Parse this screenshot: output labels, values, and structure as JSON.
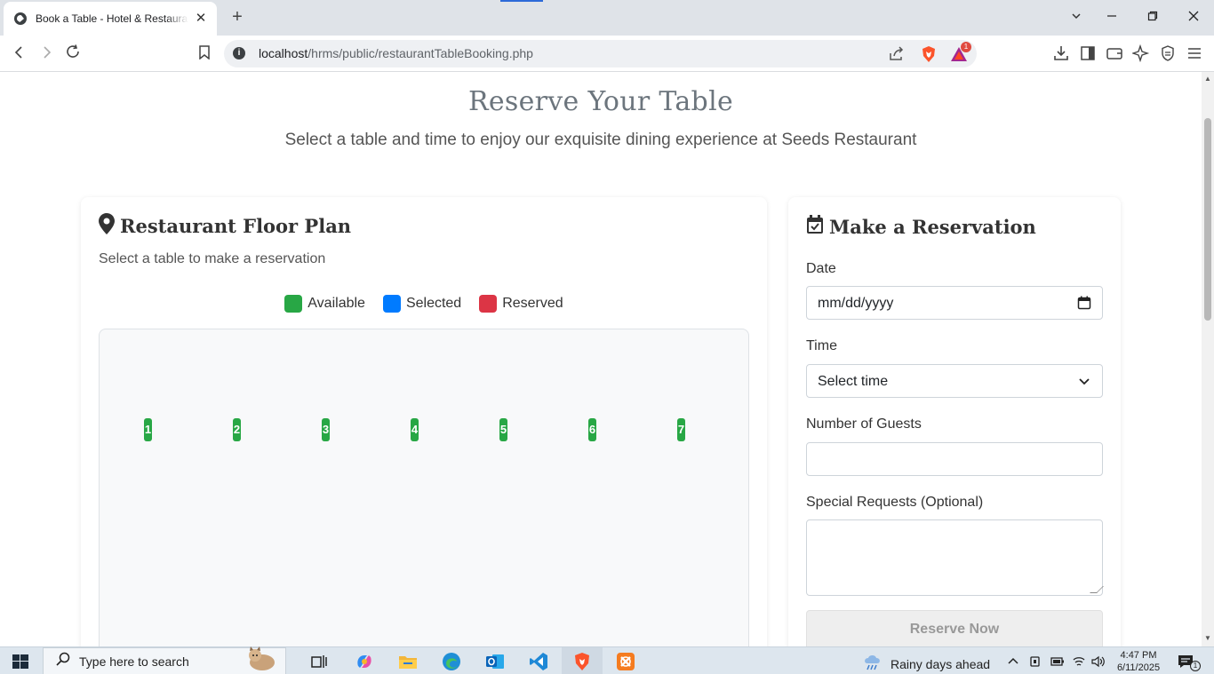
{
  "browser": {
    "tab_title": "Book a Table - Hotel & Restaurant",
    "url_host": "localhost",
    "url_path": "/hrms/public/restaurantTableBooking.php",
    "extension_badge": "1"
  },
  "page": {
    "title": "Reserve Your Table",
    "subtitle": "Select a table and time to enjoy our exquisite dining experience at Seeds Restaurant"
  },
  "floor_plan": {
    "heading": "Restaurant Floor Plan",
    "subheading": "Select a table to make a reservation",
    "legend": [
      {
        "label": "Available",
        "color": "#28a745"
      },
      {
        "label": "Selected",
        "color": "#007bff"
      },
      {
        "label": "Reserved",
        "color": "#dc3545"
      }
    ],
    "tables": [
      "1",
      "2",
      "3",
      "4",
      "5",
      "6",
      "7"
    ]
  },
  "reservation": {
    "heading": "Make a Reservation",
    "date_label": "Date",
    "date_placeholder": "mm/dd/yyyy",
    "time_label": "Time",
    "time_value": "Select time",
    "guests_label": "Number of Guests",
    "guests_value": "",
    "requests_label": "Special Requests (Optional)",
    "requests_value": "",
    "submit_label": "Reserve Now"
  },
  "taskbar": {
    "search_placeholder": "Type here to search",
    "weather": "Rainy days ahead",
    "time": "4:47 PM",
    "date": "6/11/2025",
    "notification_count": "1"
  }
}
